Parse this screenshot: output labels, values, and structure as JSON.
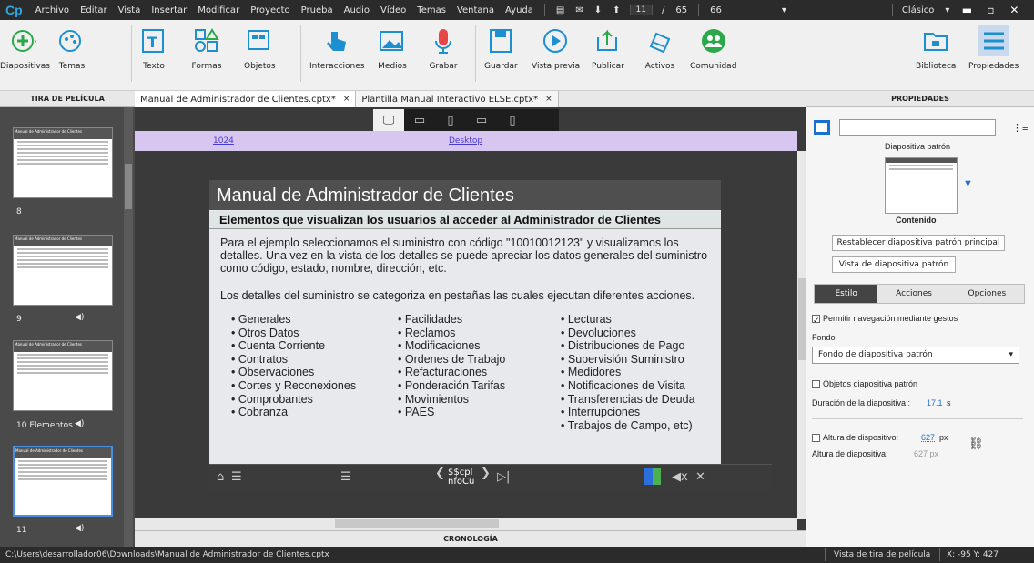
{
  "menu": {
    "logo": "Cp",
    "items": [
      "Archivo",
      "Editar",
      "Vista",
      "Insertar",
      "Modificar",
      "Proyecto",
      "Prueba",
      "Audio",
      "Vídeo",
      "Temas",
      "Ventana",
      "Ayuda"
    ],
    "page_current": "11",
    "page_sep": "/",
    "page_total": "65",
    "page_extra": "66",
    "mode": "Clásico"
  },
  "toolbar": {
    "diapositivas": "Diapositivas",
    "temas": "Temas",
    "texto": "Texto",
    "formas": "Formas",
    "objetos": "Objetos",
    "interacciones": "Interacciones",
    "medios": "Medios",
    "grabar": "Grabar",
    "guardar": "Guardar",
    "vista_previa": "Vista previa",
    "publicar": "Publicar",
    "activos": "Activos",
    "comunidad": "Comunidad",
    "biblioteca": "Biblioteca",
    "propiedades": "Propiedades"
  },
  "filmstrip": {
    "header": "TIRA DE PELÍCULA",
    "thumbs": [
      {
        "label": "8"
      },
      {
        "label": "9"
      },
      {
        "label": "10 Elementos ..."
      },
      {
        "label": "11"
      }
    ],
    "thumb_title": "Manual de Administrador de Clientes"
  },
  "tabs": [
    {
      "label": "Manual de Administrador de Clientes.cptx*"
    },
    {
      "label": "Plantilla Manual Interactivo ELSE.cptx*"
    }
  ],
  "tab_close": "×",
  "ruler": {
    "width": "1024",
    "device": "Desktop"
  },
  "slide": {
    "title": "Manual de Administrador de Clientes",
    "subtitle": "Elementos que visualizan los usuarios al acceder al Administrador de Clientes",
    "para1": "Para el ejemplo seleccionamos el suministro con código \"10010012123\" y visualizamos los detalles. Una vez en la vista de los detalles se puede apreciar los datos generales del suministro como código, estado, nombre, dirección, etc.",
    "para2": "Los detalles del suministro se categoriza en pestañas las cuales ejecutan diferentes acciones.",
    "col1": [
      "Generales",
      "Otros Datos",
      "Cuenta Corriente",
      "Contratos",
      "Observaciones",
      "Cortes y Reconexiones",
      "Comprobantes",
      "Cobranza"
    ],
    "col2": [
      "Facilidades",
      "Reclamos",
      "Modificaciones",
      "Ordenes de Trabajo",
      "Refacturaciones",
      "Ponderación Tarifas",
      "Movimientos",
      "PAES"
    ],
    "col3": [
      "Lecturas",
      "Devoluciones",
      "Distribuciones de Pago",
      "Supervisión Suministro",
      "Medidores",
      "Notificaciones de Visita",
      "Transferencias de Deuda",
      "Interrupciones",
      "Trabajos de Campo, etc)"
    ],
    "playbar_text": "$$cpl nfoCu"
  },
  "cronologia": "CRONOLOGÍA",
  "props": {
    "header": "PROPIEDADES",
    "master_label": "Diapositiva patrón",
    "content_label": "Contenido",
    "reset_btn": "Restablecer diapositiva patrón principal",
    "view_btn": "Vista de diapositiva patrón",
    "tabs": [
      "Estilo",
      "Acciones",
      "Opciones"
    ],
    "gesture": "Permitir navegación mediante gestos",
    "fondo_label": "Fondo",
    "fondo_value": "Fondo de diapositiva patrón",
    "objetos": "Objetos diapositiva patrón",
    "duracion_label": "Duración de la diapositiva :",
    "duracion_value": "17.1",
    "duracion_unit": "s",
    "altura_label": "Altura de dispositivo:",
    "altura_value": "627",
    "altura_unit": "px",
    "altura2_label": "Altura de diapositiva:",
    "altura2_value": "627 px"
  },
  "status": {
    "path": "C:\\Users\\desarrollador06\\Downloads\\Manual de Administrador de Clientes.cptx",
    "view": "Vista de tira de película",
    "coords": "X: -95 Y: 427"
  }
}
